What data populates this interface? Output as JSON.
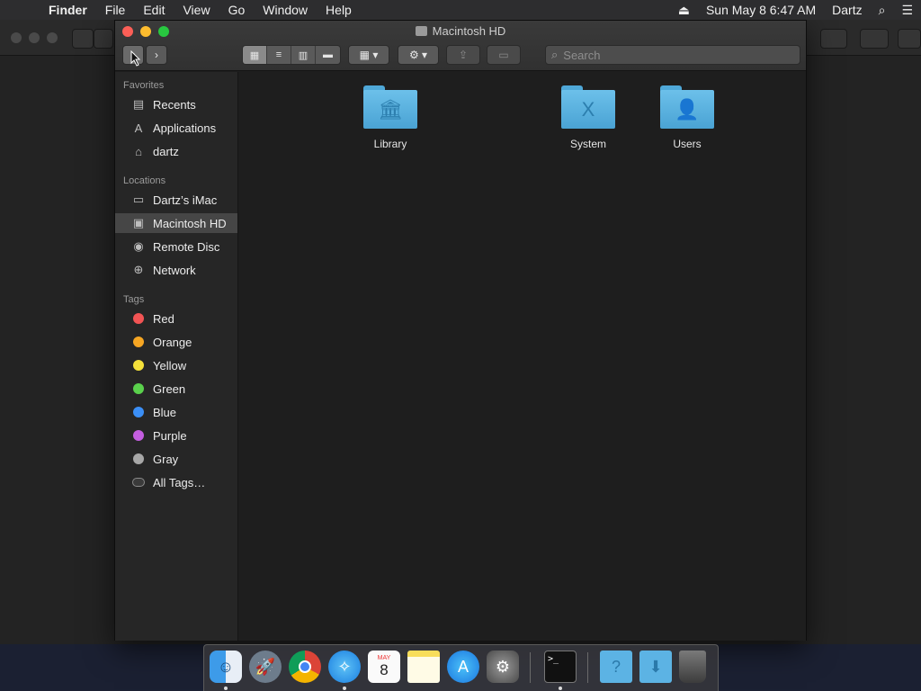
{
  "menubar": {
    "app_name": "Finder",
    "items": [
      "File",
      "Edit",
      "View",
      "Go",
      "Window",
      "Help"
    ],
    "datetime": "Sun May 8  6:47 AM",
    "user": "Dartz"
  },
  "window": {
    "title": "Macintosh HD",
    "search_placeholder": "Search"
  },
  "sidebar": {
    "favorites_header": "Favorites",
    "favorites": [
      {
        "label": "Recents",
        "icon": "recents-icon"
      },
      {
        "label": "Applications",
        "icon": "applications-icon"
      },
      {
        "label": "dartz",
        "icon": "home-icon"
      }
    ],
    "locations_header": "Locations",
    "locations": [
      {
        "label": "Dartz’s iMac",
        "icon": "imac-icon"
      },
      {
        "label": "Macintosh HD",
        "icon": "hard-drive-icon"
      },
      {
        "label": "Remote Disc",
        "icon": "disc-icon"
      },
      {
        "label": "Network",
        "icon": "network-icon"
      }
    ],
    "tags_header": "Tags",
    "tags": [
      {
        "label": "Red",
        "color": "#f25454"
      },
      {
        "label": "Orange",
        "color": "#f6a623"
      },
      {
        "label": "Yellow",
        "color": "#f5e13a"
      },
      {
        "label": "Green",
        "color": "#5ad14c"
      },
      {
        "label": "Blue",
        "color": "#3b8ff6"
      },
      {
        "label": "Purple",
        "color": "#c45ee0"
      },
      {
        "label": "Gray",
        "color": "#a7a7a7"
      }
    ],
    "all_tags": "All Tags…",
    "selected": "Macintosh HD"
  },
  "content": {
    "folders": [
      {
        "label": "Library",
        "icon": "library-folder-icon"
      },
      {
        "label": "System",
        "icon": "system-folder-icon"
      },
      {
        "label": "Users",
        "icon": "users-folder-icon"
      }
    ]
  },
  "dock": {
    "apps": [
      "finder-icon",
      "launchpad-icon",
      "chrome-icon",
      "safari-icon",
      "calendar-icon",
      "notes-icon",
      "app-store-icon",
      "system-preferences-icon",
      "terminal-icon",
      "help-folder-icon",
      "downloads-folder-icon",
      "trash-icon"
    ],
    "calendar_month": "MAY",
    "calendar_day": "8"
  }
}
